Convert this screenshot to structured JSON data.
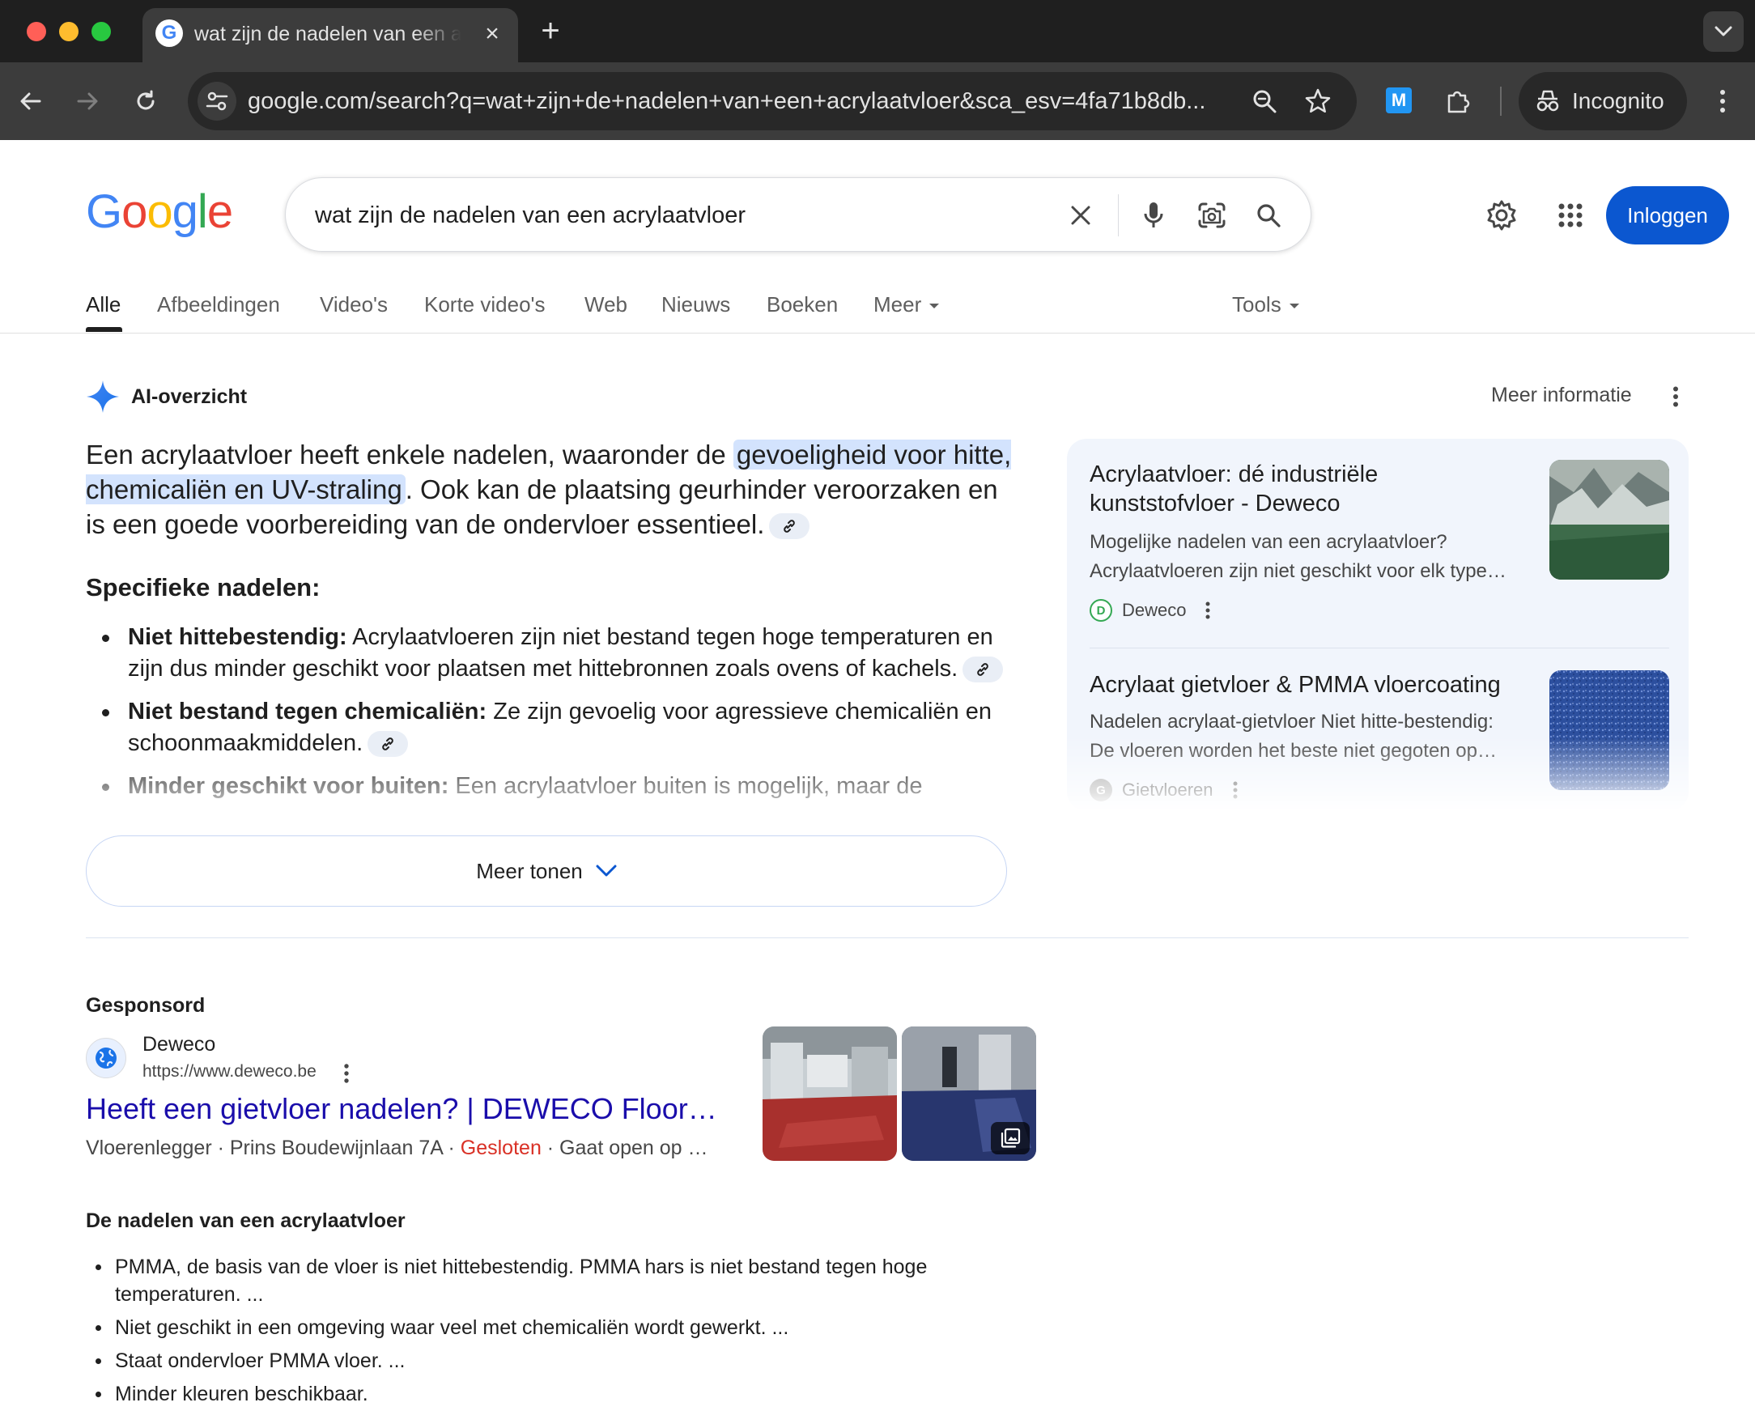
{
  "browser": {
    "tab_title": "wat zijn de nadelen van een acrylaatvloer",
    "new_tab_label": "+",
    "tab_close_label": "×",
    "favicon_letter": "G",
    "url_host": "google.com",
    "url_rest": "/search?q=wat+zijn+de+nadelen+van+een+acrylaatvloer&sca_esv=4fa71b8db...",
    "extension_letter": "M",
    "profile_label": "Incognito"
  },
  "google": {
    "logo_letters": [
      "G",
      "o",
      "o",
      "g",
      "l",
      "e"
    ],
    "query": "wat zijn de nadelen van een acrylaatvloer",
    "signin_label": "Inloggen"
  },
  "search_tabs": [
    {
      "label": "Alle",
      "active": true
    },
    {
      "label": "Afbeeldingen"
    },
    {
      "label": "Video's"
    },
    {
      "label": "Korte video's"
    },
    {
      "label": "Web"
    },
    {
      "label": "Nieuws"
    },
    {
      "label": "Boeken"
    },
    {
      "label": "Meer"
    }
  ],
  "tools_label": "Tools",
  "ai_overview": {
    "title": "AI-overzicht",
    "more_info": "Meer informatie",
    "intro_before": "Een acrylaatvloer heeft enkele nadelen, waaronder de ",
    "intro_highlight": "gevoeligheid voor hitte, chemicaliën en UV-straling",
    "intro_after": ". Ook kan de plaatsing geurhinder veroorzaken en is een goede voorbereiding van de ondervloer essentieel.",
    "subheading": "Specifieke nadelen:",
    "items": [
      {
        "bold": "Niet hittebestendig:",
        "text": " Acrylaatvloeren zijn niet bestand tegen hoge temperaturen en zijn dus minder geschikt voor plaatsen met hittebronnen zoals ovens of kachels."
      },
      {
        "bold": "Niet bestand tegen chemicaliën:",
        "text": " Ze zijn gevoelig voor agressieve chemicaliën en schoonmaakmiddelen."
      },
      {
        "bold": "Minder geschikt voor buiten:",
        "text": " Een acrylaatvloer buiten is mogelijk, maar de"
      }
    ],
    "show_more": "Meer tonen",
    "sources": [
      {
        "title": "Acrylaatvloer: dé industriële kunststofvloer - Deweco",
        "snippet_line1": "Mogelijke nadelen van een acrylaatvloer?",
        "snippet_line2": "Acrylaatvloeren zijn niet geschikt voor elk type…",
        "site": "Deweco",
        "favicon_letter": "D"
      },
      {
        "title": "Acrylaat gietvloer & PMMA vloercoating",
        "snippet_line1": "Nadelen acrylaat-gietvloer Niet hitte-bestendig:",
        "snippet_line2": "De vloeren worden het beste niet gegoten op…",
        "site": "Gietvloeren",
        "favicon_letter": "G"
      }
    ]
  },
  "sponsored": {
    "label": "Gesponsord",
    "advertiser": "Deweco",
    "url": "https://www.deweco.be",
    "title": "Heeft een gietvloer nadelen? | DEWECO Floor…",
    "meta_before": "Vloerenlegger · Prins Boudewijnlaan 7A · ",
    "meta_status": "Gesloten",
    "meta_after": " · Gaat open op …"
  },
  "snippet": {
    "heading": "De nadelen van een acrylaatvloer",
    "items": [
      "PMMA, de basis van de vloer is niet hittebestendig. PMMA hars is niet bestand tegen hoge temperaturen. ...",
      "Niet geschikt in een omgeving waar veel met chemicaliën wordt gewerkt. ...",
      "Staat ondervloer PMMA vloer. ...",
      "Minder kleuren beschikbaar."
    ]
  },
  "colors": {
    "accent_blue": "#0b57d0",
    "link": "#1a0dab",
    "closed_red": "#d93025",
    "highlight": "#d3e3fd"
  }
}
